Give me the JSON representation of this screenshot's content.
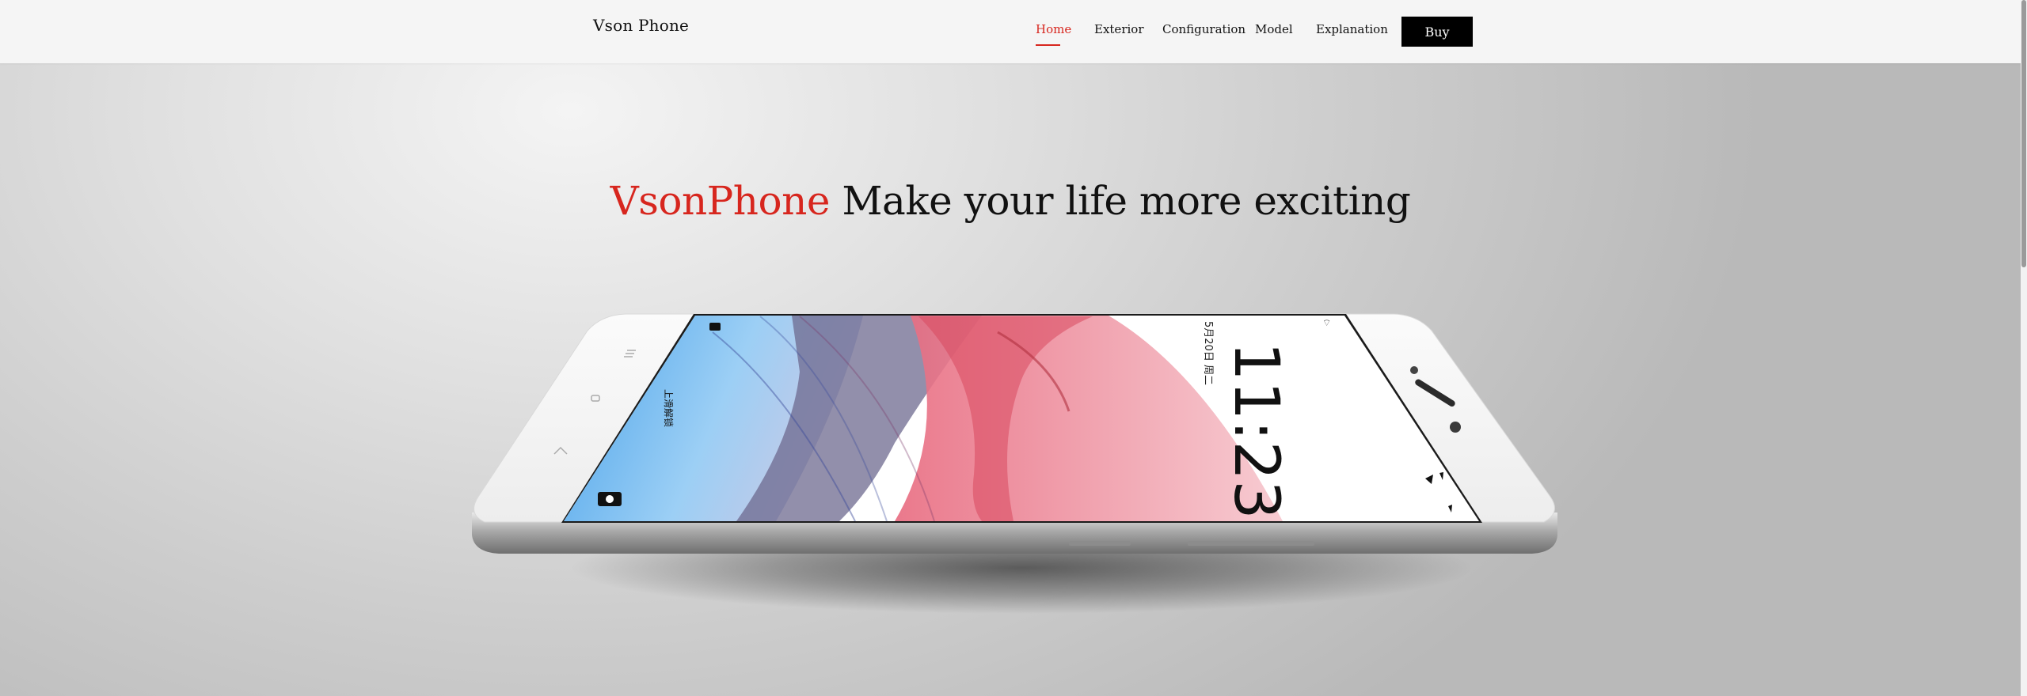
{
  "header": {
    "brand": "Vson Phone",
    "nav": [
      {
        "label": "Home",
        "active": true
      },
      {
        "label": "Exterior",
        "active": false
      },
      {
        "label": "Configuration",
        "active": false
      },
      {
        "label": "Model",
        "active": false
      },
      {
        "label": "Explanation",
        "active": false
      }
    ],
    "buy_label": "Buy"
  },
  "hero": {
    "brand_word": "VsonPhone",
    "tagline": "Make your life more exciting"
  },
  "phone_screen": {
    "time": "11:23",
    "date": "5月20日 周二",
    "swipe_hint": "上滑解锁"
  },
  "colors": {
    "accent": "#d7261e",
    "button_bg": "#000000",
    "header_bg": "#f5f5f5"
  }
}
